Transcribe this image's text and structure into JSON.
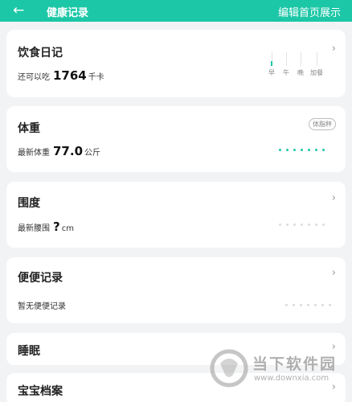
{
  "header": {
    "back_icon": "arrow-left-icon",
    "title": "健康记录",
    "action_label": "编辑首页展示"
  },
  "diet": {
    "title": "饮食日记",
    "remaining_label": "还可以吃",
    "remaining_value": "1764",
    "unit": "千卡",
    "meals": [
      {
        "label": "早",
        "fill": 0.35
      },
      {
        "label": "午",
        "fill": 0
      },
      {
        "label": "晚",
        "fill": 0
      },
      {
        "label": "加餐",
        "fill": 0
      }
    ]
  },
  "weight": {
    "title": "体重",
    "badge": "体脂秤",
    "latest_label": "最新体重",
    "latest_value": "77.0",
    "unit": "公斤"
  },
  "girth": {
    "title": "围度",
    "latest_label": "最新腰围",
    "latest_value": "?",
    "unit": "cm"
  },
  "bowel": {
    "title": "便便记录",
    "empty_text": "暂无便便记录"
  },
  "sleep": {
    "title": "睡眠"
  },
  "baby": {
    "title": "宝宝档案"
  },
  "watermark": {
    "name": "当下软件园",
    "url": "www.downxia.com"
  },
  "colors": {
    "accent": "#1cc7a7",
    "card": "#ffffff",
    "background": "#f2f3f5"
  }
}
